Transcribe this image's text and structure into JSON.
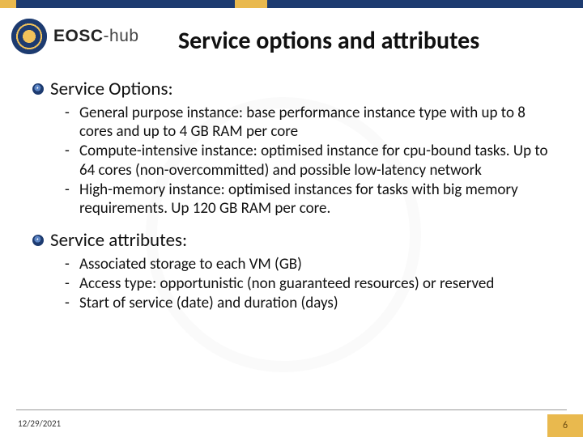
{
  "brand": {
    "name_bold": "EOSC",
    "name_thin": "-hub"
  },
  "title": "Service options and attributes",
  "sections": [
    {
      "heading": "Service Options:",
      "items": [
        "General purpose instance: base performance instance type with up to 8 cores and up to 4 GB RAM per core",
        "Compute-intensive instance: optimised instance for cpu-bound tasks. Up to 64 cores (non-overcommitted) and possible low-latency network",
        "High-memory instance: optimised instances for tasks with big memory requirements. Up 120 GB RAM per core."
      ]
    },
    {
      "heading": "Service attributes:",
      "items": [
        "Associated storage to each VM (GB)",
        "Access type: opportunistic (non guaranteed resources) or reserved",
        "Start of service (date) and duration (days)"
      ]
    }
  ],
  "footer": {
    "date": "12/29/2021",
    "page": "6"
  }
}
